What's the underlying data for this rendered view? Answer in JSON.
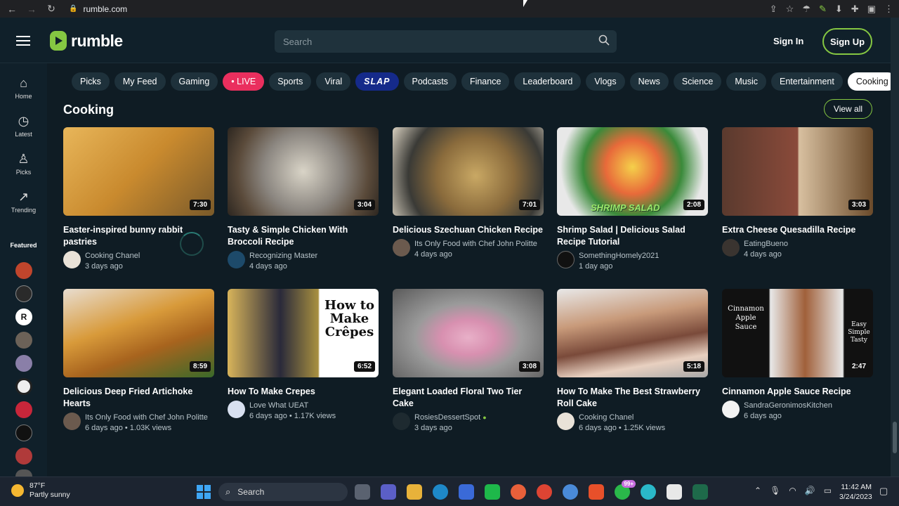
{
  "browser": {
    "url": "rumble.com"
  },
  "header": {
    "logo_text": "rumble",
    "search_placeholder": "Search",
    "signin": "Sign In",
    "signup": "Sign Up"
  },
  "sidebar": {
    "items": [
      {
        "label": "Home",
        "icon": "home-icon"
      },
      {
        "label": "Latest",
        "icon": "clock-icon"
      },
      {
        "label": "Picks",
        "icon": "picks-icon"
      },
      {
        "label": "Trending",
        "icon": "trending-icon"
      }
    ],
    "featured_label": "Featured",
    "featured_letter": "R"
  },
  "chips": [
    "Picks",
    "My Feed",
    "Gaming",
    "• LIVE",
    "Sports",
    "Viral",
    "SLAP",
    "Podcasts",
    "Finance",
    "Leaderboard",
    "Vlogs",
    "News",
    "Science",
    "Music",
    "Entertainment",
    "Cooking"
  ],
  "section": {
    "title": "Cooking",
    "view_all": "View all"
  },
  "videos": [
    {
      "title": "Easter-inspired bunny rabbit pastries",
      "channel": "Cooking Chanel",
      "meta": "3 days ago",
      "duration": "7:30"
    },
    {
      "title": "Tasty & Simple Chicken With Broccoli Recipe",
      "channel": "Recognizing Master",
      "meta": "4 days ago",
      "duration": "3:04"
    },
    {
      "title": "Delicious Szechuan Chicken Recipe",
      "channel": "Its Only Food with Chef John Politte",
      "meta": "4 days ago",
      "duration": "7:01"
    },
    {
      "title": "Shrimp Salad | Delicious Salad Recipe Tutorial",
      "channel": "SomethingHomely2021",
      "meta": "1 day ago",
      "duration": "2:08",
      "overlay": "SHRIMP SALAD"
    },
    {
      "title": "Extra Cheese Quesadilla Recipe",
      "channel": "EatingBueno",
      "meta": "4 days ago",
      "duration": "3:03"
    },
    {
      "title": "Delicious Deep Fried Artichoke Hearts",
      "channel": "Its Only Food with Chef John Politte",
      "meta": "6 days ago • 1.03K views",
      "duration": "8:59"
    },
    {
      "title": "How To Make Crepes",
      "channel": "Love What UEAT",
      "meta": "6 days ago • 1.17K views",
      "duration": "6:52",
      "overlay": "How to Make Crêpes"
    },
    {
      "title": "Elegant Loaded Floral Two Tier Cake",
      "channel": "RosiesDessertSpot",
      "meta": "3 days ago",
      "duration": "3:08"
    },
    {
      "title": "How To Make The Best Strawberry Roll Cake",
      "channel": "Cooking Chanel",
      "meta": "6 days ago • 1.25K views",
      "duration": "5:18"
    },
    {
      "title": "Cinnamon Apple Sauce Recipe",
      "channel": "SandraGeronimosKitchen",
      "meta": "6 days ago",
      "duration": "2:47",
      "overlay_left": "Cinnamon Apple Sauce",
      "overlay_right": "Easy Simple Tasty"
    }
  ],
  "taskbar": {
    "weather_temp": "87°F",
    "weather_desc": "Partly sunny",
    "search": "Search",
    "badge": "99+",
    "time": "11:42 AM",
    "date": "3/24/2023"
  },
  "colors": {
    "brand": "#85c742",
    "live": "#ea2f5e",
    "background": "#0f1c24"
  }
}
